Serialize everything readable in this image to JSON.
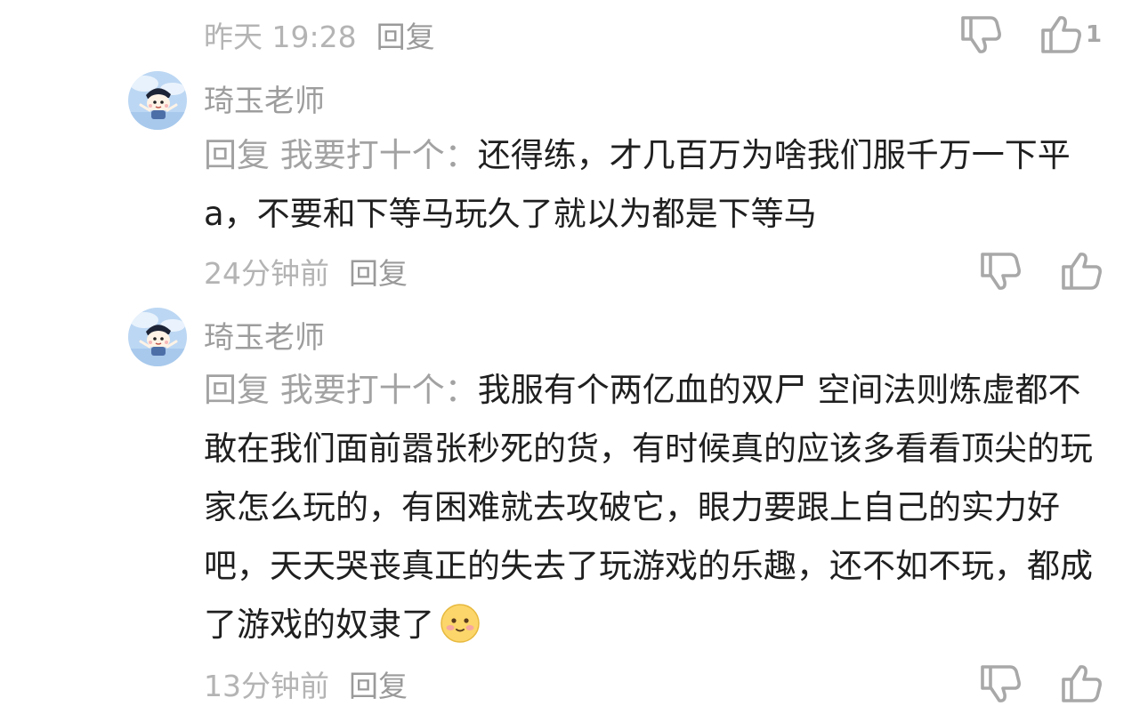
{
  "top_meta": {
    "time": "昨天 19:28",
    "reply_label": "回复",
    "like_count": "1"
  },
  "comments": [
    {
      "username": "琦玉老师",
      "reply_prefix": "回复 我要打十个：",
      "text": "还得练，才几百万为啥我们服千万一下平 a，不要和下等马玩久了就以为都是下等马",
      "time": "24分钟前",
      "reply_label": "回复"
    },
    {
      "username": "琦玉老师",
      "reply_prefix": "回复 我要打十个：",
      "text": "我服有个两亿血的双尸 空间法则炼虚都不敢在我们面前嚣张秒死的货，有时候真的应该多看看顶尖的玩家怎么玩的，有困难就去攻破它，眼力要跟上自己的实力好吧，天天哭丧真正的失去了玩游戏的乐趣，还不如不玩，都成了游戏的奴隶了",
      "emoji": "smiling-blush-emoji",
      "time": "13分钟前",
      "reply_label": "回复"
    }
  ],
  "icons": {
    "dislike": "thumbs-down-icon",
    "like": "thumbs-up-icon"
  },
  "colors": {
    "meta_text": "#b4b4b4",
    "icon_stroke": "#a8a8a8",
    "body_text": "#1f1f1f",
    "username": "#9d9d9d"
  }
}
